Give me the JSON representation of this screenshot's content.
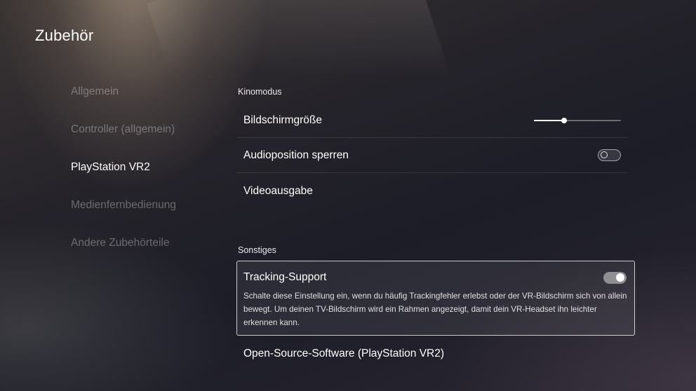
{
  "header": {
    "title": "Zubehör"
  },
  "sidebar": {
    "items": [
      {
        "label": "Allgemein",
        "active": false
      },
      {
        "label": "Controller (allgemein)",
        "active": false
      },
      {
        "label": "PlayStation VR2",
        "active": true
      },
      {
        "label": "Medienfernbedienung",
        "active": false
      },
      {
        "label": "Andere Zubehörteile",
        "active": false
      }
    ]
  },
  "main": {
    "kinomodus": {
      "heading": "Kinomodus",
      "screen_size": {
        "label": "Bildschirmgröße",
        "slider_value_fraction": 0.35
      },
      "audio_lock": {
        "label": "Audioposition sperren",
        "toggle_state": "off"
      },
      "video_output": {
        "label": "Videoausgabe"
      }
    },
    "sonstiges": {
      "heading": "Sonstiges",
      "tracking_support": {
        "label": "Tracking-Support",
        "toggle_state": "on",
        "description": "Schalte diese Einstellung ein, wenn du häufig Trackingfehler erlebst oder der VR-Bildschirm sich von allein bewegt. Um deinen TV-Bildschirm wird ein Rahmen angezeigt, damit dein VR-Headset ihn leichter erkennen kann."
      },
      "open_source": {
        "label": "Open-Source-Software (PlayStation VR2)"
      }
    }
  }
}
